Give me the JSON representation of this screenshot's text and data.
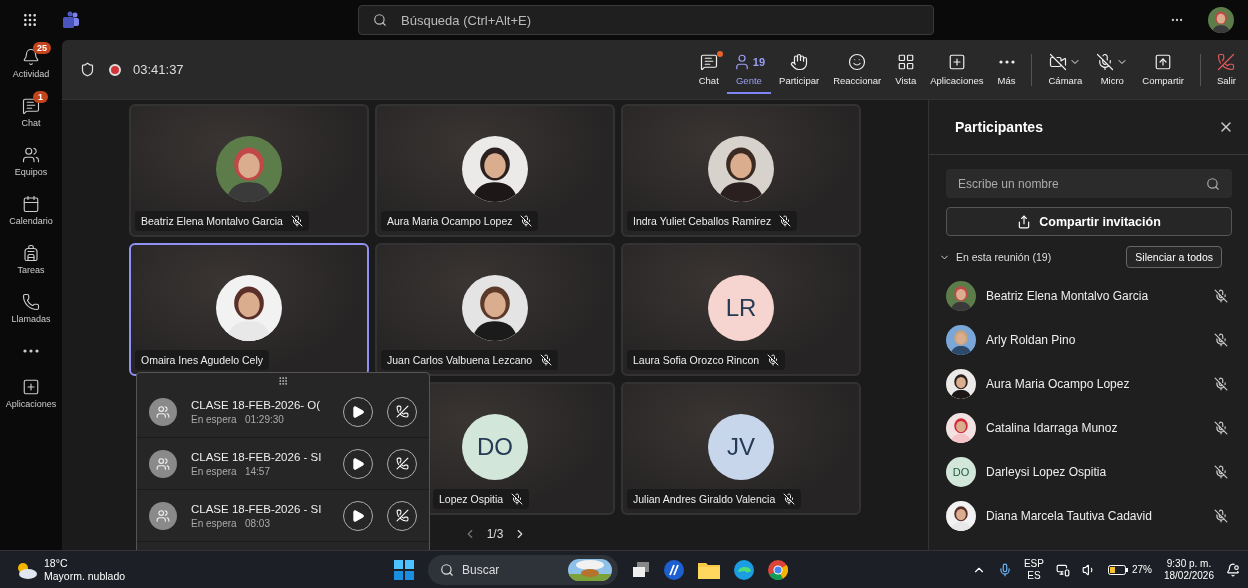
{
  "app_bar": {
    "search": {
      "placeholder": "Búsqueda (Ctrl+Alt+E)"
    }
  },
  "rail": [
    {
      "kind": "app",
      "label": "Actividad",
      "badge": "25"
    },
    {
      "kind": "app",
      "label": "Chat",
      "badge": "1"
    },
    {
      "kind": "app",
      "label": "Equipos"
    },
    {
      "kind": "app",
      "label": "Calendario"
    },
    {
      "kind": "app",
      "label": "Tareas"
    },
    {
      "kind": "app",
      "label": "Llamadas"
    },
    {
      "kind": "more"
    },
    {
      "kind": "app",
      "label": "Aplicaciones"
    }
  ],
  "meeting": {
    "timer": "03:41:37",
    "recording": true,
    "toolbar": [
      [
        {
          "label": "Chat",
          "kind": "button",
          "selected": false,
          "notification": true
        },
        {
          "label": "Gente",
          "count": "19",
          "kind": "button",
          "selected": true,
          "notification": false
        },
        {
          "label": "Participar",
          "kind": "button",
          "selected": false,
          "notification": false
        },
        {
          "label": "Reaccionar",
          "kind": "button",
          "selected": false,
          "notification": false
        },
        {
          "label": "Vista",
          "kind": "button",
          "selected": false,
          "notification": false
        },
        {
          "label": "Aplicaciones",
          "kind": "button",
          "selected": false,
          "notification": false
        },
        {
          "label": "Más",
          "kind": "button",
          "selected": false,
          "notification": false
        }
      ],
      [
        {
          "label": "Cámara",
          "kind": "split",
          "selected": false,
          "notification": false
        },
        {
          "label": "Micro",
          "kind": "split",
          "selected": false,
          "notification": false
        },
        {
          "label": "Compartir",
          "kind": "button",
          "selected": false,
          "notification": false
        }
      ],
      [
        {
          "label": "Salir",
          "kind": "leave",
          "selected": false,
          "notification": false
        }
      ]
    ]
  },
  "tiles": [
    {
      "name": "Beatriz Elena Montalvo Garcia",
      "muted": true,
      "speaking": false
    },
    {
      "name": "Aura Maria Ocampo Lopez",
      "muted": true,
      "speaking": false
    },
    {
      "name": "Indra Yuliet Ceballos Ramirez",
      "muted": true,
      "speaking": false
    },
    {
      "name": "Omaira Ines Agudelo Cely",
      "muted": false,
      "speaking": true
    },
    {
      "name": "Juan Carlos Valbuena Lezcano",
      "muted": true,
      "speaking": false
    },
    {
      "name": "Laura Sofia Orozco Rincon",
      "kind": "initials",
      "initials": "LR",
      "color": "#f6d4cf",
      "muted": true,
      "speaking": false
    },
    {
      "kind": "hidden"
    },
    {
      "name": "Lopez Ospitia",
      "kind": "initials",
      "initials": "DO",
      "color": "#d3e6da",
      "muted": true,
      "speaking": false,
      "covered": true
    },
    {
      "name": "Julian Andres Giraldo Valencia",
      "kind": "initials",
      "initials": "JV",
      "color": "#c8d6ec",
      "muted": true,
      "speaking": false
    }
  ],
  "pager": "1/3",
  "holding_calls": [
    {
      "title": "CLASE 18-FEB-2026- O(",
      "status": "En espera",
      "time": "01:29:30"
    },
    {
      "title": "CLASE 18-FEB-2026 - SI",
      "status": "En espera",
      "time": "14:57"
    },
    {
      "title": "CLASE 18-FEB-2026 - SI",
      "status": "En espera",
      "time": "08:03"
    }
  ],
  "participants_panel": {
    "title": "Participantes",
    "search": {
      "placeholder": "Escribe un nombre"
    },
    "share_button": "Compartir invitación",
    "section": {
      "label": "En esta reunión (19)",
      "expanded": true,
      "mute_all": "Silenciar a todos"
    },
    "people": [
      {
        "name": "Beatriz Elena Montalvo Garcia",
        "muted": true
      },
      {
        "name": "Arly Roldan Pino",
        "muted": true
      },
      {
        "name": "Aura Maria Ocampo Lopez",
        "muted": true
      },
      {
        "name": "Catalina Idarraga Munoz",
        "muted": true
      },
      {
        "name": "Darleysi Lopez Ospitia",
        "kind": "initials",
        "initials": "DO",
        "color": "#d3e6da",
        "muted": true
      },
      {
        "name": "Diana Marcela Tautiva Cadavid",
        "muted": true
      }
    ]
  },
  "taskbar": {
    "weather": {
      "temp": "18°C",
      "desc": "Mayorm. nublado"
    },
    "search": "Buscar",
    "lang": "ESP",
    "layout": "ES",
    "battery": "27%",
    "time": "9:30 p. m.",
    "date": "18/02/2026"
  }
}
